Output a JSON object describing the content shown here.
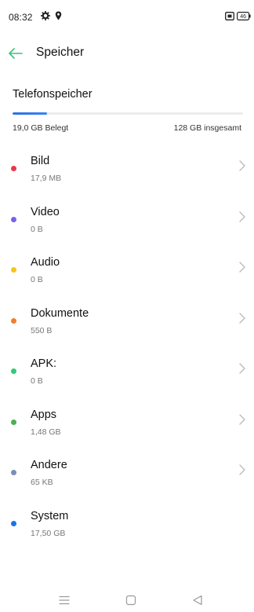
{
  "status_bar": {
    "time": "08:32",
    "icons": [
      "gear-icon",
      "location-pin-icon",
      "cast-icon",
      "battery-icon"
    ],
    "battery_level": "46"
  },
  "app_bar": {
    "back_icon": "arrow-left-icon",
    "title": "Speicher",
    "accent": "#3fbf7f"
  },
  "storage": {
    "section_title": "Telefonspeicher",
    "used_label": "19,0 GB Belegt",
    "total_label": "128 GB insgesamt",
    "used_fraction": 0.15,
    "bar_color": "#2f6fe0"
  },
  "categories": [
    {
      "name": "Bild",
      "size": "17,9 MB",
      "color": "#e8384f",
      "has_chevron": true
    },
    {
      "name": "Video",
      "size": "0 B",
      "color": "#7b61e8",
      "has_chevron": true
    },
    {
      "name": "Audio",
      "size": "0 B",
      "color": "#f5c518",
      "has_chevron": true
    },
    {
      "name": "Dokumente",
      "size": "550 B",
      "color": "#f07f2d",
      "has_chevron": true
    },
    {
      "name": "APK:",
      "size": "0 B",
      "color": "#2ecc71",
      "has_chevron": true
    },
    {
      "name": "Apps",
      "size": "1,48 GB",
      "color": "#4caf50",
      "has_chevron": true
    },
    {
      "name": "Andere",
      "size": "65 KB",
      "color": "#7a8fb8",
      "has_chevron": true
    },
    {
      "name": "System",
      "size": "17,50 GB",
      "color": "#1a73e8",
      "has_chevron": false
    }
  ],
  "nav_bar": {
    "buttons": [
      "menu-icon",
      "home-square-icon",
      "back-triangle-icon"
    ]
  }
}
